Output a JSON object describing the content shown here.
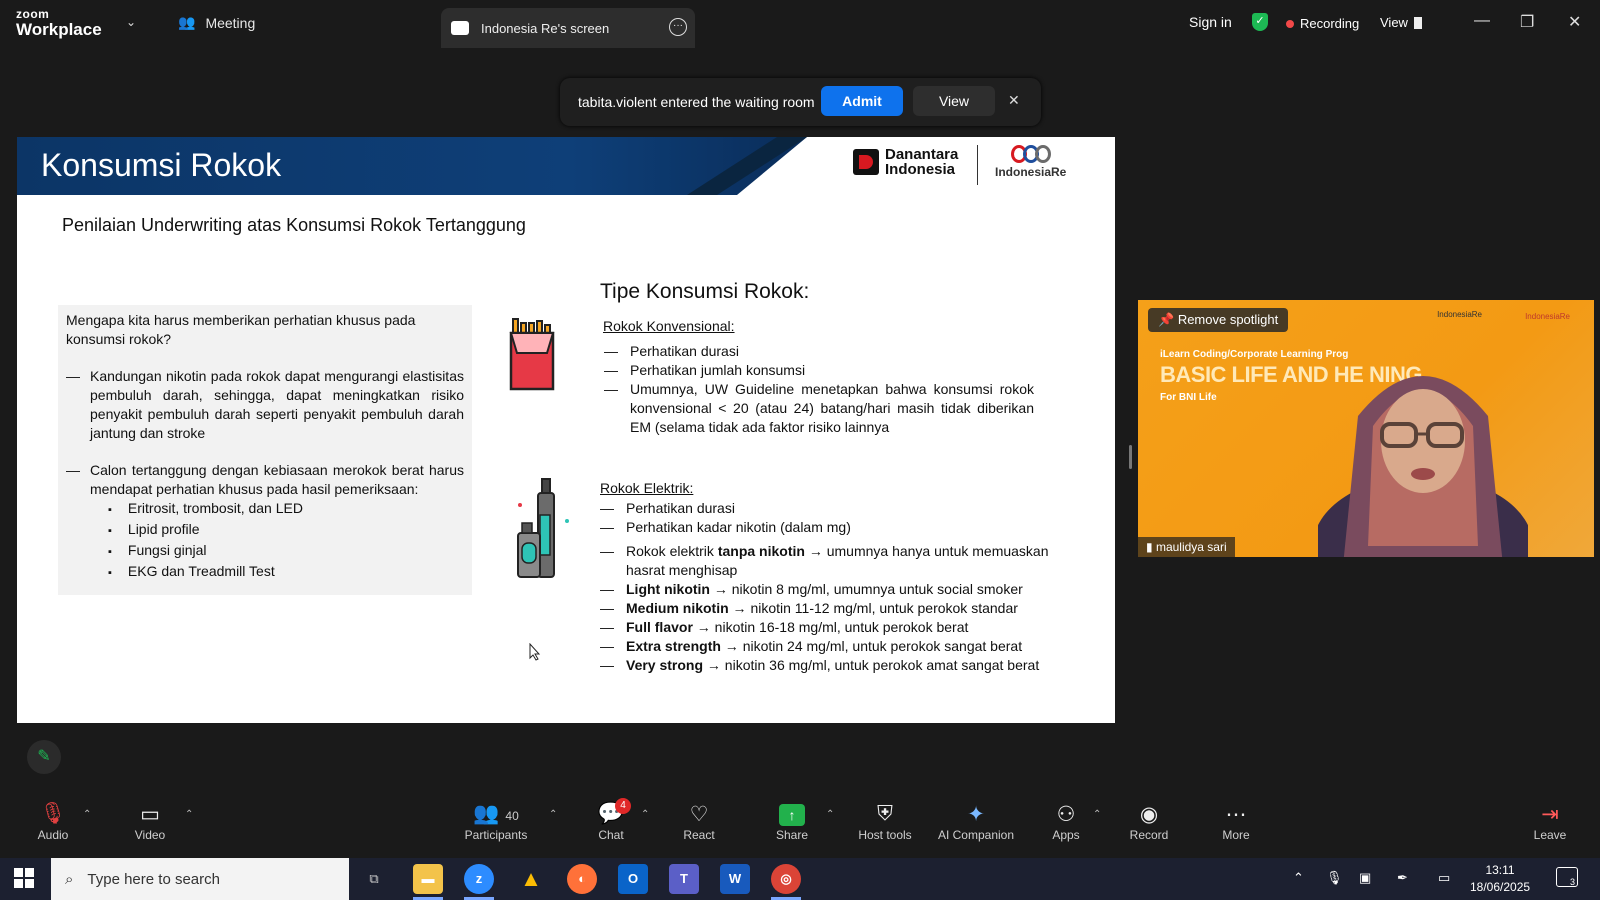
{
  "titlebar": {
    "logo_line1": "zoom",
    "logo_line2": "Workplace",
    "meeting_tab": "Meeting",
    "screen_tab": "Indonesia Re's screen",
    "sign_in": "Sign in",
    "recording": "Recording",
    "view": "View"
  },
  "notification": {
    "message": "tabita.violent entered the waiting room",
    "admit": "Admit",
    "view": "View",
    "close": "✕"
  },
  "slide": {
    "title": "Konsumsi Rokok",
    "brand1_line1": "Danantara",
    "brand1_line2": "Indonesia",
    "brand2": "IndonesiaRe",
    "subtitle": "Penilaian Underwriting atas Konsumsi Rokok Tertanggung",
    "left": {
      "question": "Mengapa kita harus memberikan perhatian khusus pada konsumsi rokok?",
      "bullet1": "Kandungan nikotin pada rokok dapat mengurangi elastisitas pembuluh darah, sehingga, dapat meningkatkan risiko penyakit pembuluh darah seperti penyakit pembuluh darah jantung dan stroke",
      "bullet2": "Calon tertanggung dengan kebiasaan merokok berat harus mendapat perhatian khusus pada hasil pemeriksaan:",
      "sub": [
        "Eritrosit, trombosit, dan LED",
        "Lipid profile",
        "Fungsi ginjal",
        "EKG dan Treadmill Test"
      ]
    },
    "tipe_title": "Tipe Konsumsi Rokok:",
    "konv": {
      "heading": "Rokok Konvensional:",
      "items": [
        "Perhatikan durasi",
        "Perhatikan jumlah konsumsi",
        "Umumnya, UW Guideline menetapkan bahwa konsumsi rokok konvensional < 20 (atau 24) batang/hari masih tidak diberikan EM (selama tidak ada faktor risiko lainnya"
      ]
    },
    "elek": {
      "heading": "Rokok Elektrik:",
      "items": [
        {
          "bold": "",
          "text": "Perhatikan durasi"
        },
        {
          "bold": "",
          "text": "Perhatikan kadar nikotin (dalam mg)"
        },
        {
          "pre": "Rokok elektrik ",
          "bold": "tanpa nikotin",
          "text": " → umumnya hanya untuk memuaskan hasrat menghisap"
        },
        {
          "bold": "Light nikotin",
          "text": " → nikotin 8 mg/ml, umumnya untuk social smoker"
        },
        {
          "bold": "Medium nikotin",
          "text": " → nikotin 11-12 mg/ml, untuk perokok standar"
        },
        {
          "bold": "Full flavor",
          "text": " → nikotin 16-18 mg/ml, untuk perokok berat"
        },
        {
          "bold": "Extra strength",
          "text": " → nikotin 24 mg/ml, untuk perokok sangat berat"
        },
        {
          "bold": "Very strong",
          "text": " → nikotin 36 mg/ml, untuk perokok amat sangat berat"
        }
      ]
    }
  },
  "participant_video": {
    "remove_spotlight": "Remove spotlight",
    "line1": "iLearn Coding/Corporate Learning Prog",
    "title": "BASIC LIFE AND HE    NING",
    "sub": "For BNI Life",
    "logo1": "IndonesiaRe",
    "logo2": "IndonesiaRe",
    "name": "maulidya sari"
  },
  "toolbar": {
    "audio": "Audio",
    "video": "Video",
    "participants": "Participants",
    "participants_count": "40",
    "chat": "Chat",
    "chat_badge": "4",
    "react": "React",
    "share": "Share",
    "host_tools": "Host tools",
    "ai_companion": "AI Companion",
    "apps": "Apps",
    "record": "Record",
    "more": "More",
    "leave": "Leave"
  },
  "taskbar": {
    "search_placeholder": "Type here to search",
    "time": "13:11",
    "date": "18/06/2025",
    "notif_count": "3"
  }
}
